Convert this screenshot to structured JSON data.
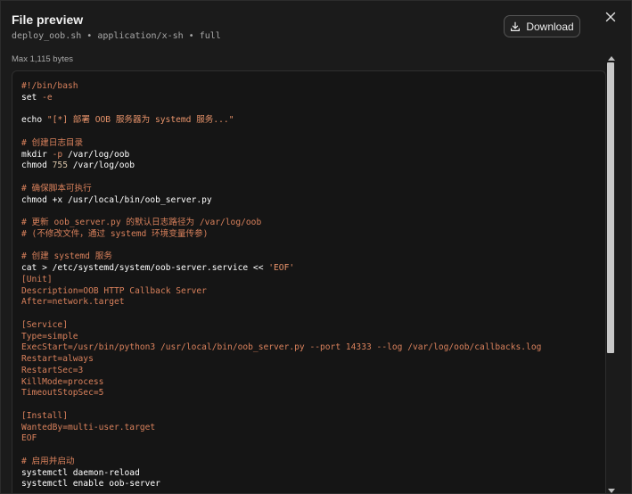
{
  "header": {
    "title": "File preview",
    "subtitle": "deploy_oob.sh • application/x-sh • full",
    "download_label": "Download"
  },
  "meta": {
    "max_bytes": "Max 1,115 bytes"
  },
  "icons": {
    "download": "download-icon",
    "close": "close-icon"
  },
  "colors": {
    "background": "#1b1b1b",
    "code_background": "#151515",
    "comment": "#d9815c",
    "command": "#ffffff",
    "string": "#e8936a"
  },
  "scroll": {
    "position": 0.0,
    "visible_fraction": 0.66
  },
  "code_lines": [
    {
      "segments": [
        {
          "t": "c-comment",
          "text": "#!/bin/bash"
        }
      ]
    },
    {
      "segments": [
        {
          "t": "c-cmd",
          "text": "set "
        },
        {
          "t": "c-flag",
          "text": "-e"
        }
      ]
    },
    {
      "segments": []
    },
    {
      "segments": [
        {
          "t": "c-cmd",
          "text": "echo "
        },
        {
          "t": "c-str",
          "text": "\"[*] 部署 OOB 服务器为 systemd 服务...\""
        }
      ]
    },
    {
      "segments": []
    },
    {
      "segments": [
        {
          "t": "c-comment",
          "text": "# 创建日志目录"
        }
      ]
    },
    {
      "segments": [
        {
          "t": "c-cmd",
          "text": "mkdir "
        },
        {
          "t": "c-flag",
          "text": "-p "
        },
        {
          "t": "c-cmd",
          "text": "/var/log/oob"
        }
      ]
    },
    {
      "segments": [
        {
          "t": "c-cmd",
          "text": "chmod "
        },
        {
          "t": "c-arg",
          "text": "755 "
        },
        {
          "t": "c-cmd",
          "text": "/var/log/oob"
        }
      ]
    },
    {
      "segments": []
    },
    {
      "segments": [
        {
          "t": "c-comment",
          "text": "# 确保脚本可执行"
        }
      ]
    },
    {
      "segments": [
        {
          "t": "c-cmd",
          "text": "chmod +x /usr/local/bin/oob_server.py"
        }
      ]
    },
    {
      "segments": []
    },
    {
      "segments": [
        {
          "t": "c-comment",
          "text": "# 更新 oob_server.py 的默认日志路径为 /var/log/oob"
        }
      ]
    },
    {
      "segments": [
        {
          "t": "c-comment",
          "text": "# (不修改文件，通过 systemd 环境变量传参)"
        }
      ]
    },
    {
      "segments": []
    },
    {
      "segments": [
        {
          "t": "c-comment",
          "text": "# 创建 systemd 服务"
        }
      ]
    },
    {
      "segments": [
        {
          "t": "c-cmd",
          "text": "cat > /etc/systemd/system/oob-server.service << "
        },
        {
          "t": "c-str",
          "text": "'EOF'"
        }
      ]
    },
    {
      "segments": [
        {
          "t": "c-ini",
          "text": "[Unit]"
        }
      ]
    },
    {
      "segments": [
        {
          "t": "c-ini",
          "text": "Description=OOB HTTP Callback Server"
        }
      ]
    },
    {
      "segments": [
        {
          "t": "c-ini",
          "text": "After=network.target"
        }
      ]
    },
    {
      "segments": []
    },
    {
      "segments": [
        {
          "t": "c-ini",
          "text": "[Service]"
        }
      ]
    },
    {
      "segments": [
        {
          "t": "c-ini",
          "text": "Type=simple"
        }
      ]
    },
    {
      "segments": [
        {
          "t": "c-ini",
          "text": "ExecStart=/usr/bin/python3 /usr/local/bin/oob_server.py --port 14333 --log /var/log/oob/callbacks.log"
        }
      ]
    },
    {
      "segments": [
        {
          "t": "c-ini",
          "text": "Restart=always"
        }
      ]
    },
    {
      "segments": [
        {
          "t": "c-ini",
          "text": "RestartSec=3"
        }
      ]
    },
    {
      "segments": [
        {
          "t": "c-ini",
          "text": "KillMode=process"
        }
      ]
    },
    {
      "segments": [
        {
          "t": "c-ini",
          "text": "TimeoutStopSec=5"
        }
      ]
    },
    {
      "segments": []
    },
    {
      "segments": [
        {
          "t": "c-ini",
          "text": "[Install]"
        }
      ]
    },
    {
      "segments": [
        {
          "t": "c-ini",
          "text": "WantedBy=multi-user.target"
        }
      ]
    },
    {
      "segments": [
        {
          "t": "c-ini",
          "text": "EOF"
        }
      ]
    },
    {
      "segments": []
    },
    {
      "segments": [
        {
          "t": "c-comment",
          "text": "# 启用并启动"
        }
      ]
    },
    {
      "segments": [
        {
          "t": "c-cmd",
          "text": "systemctl daemon-reload"
        }
      ]
    },
    {
      "segments": [
        {
          "t": "c-cmd",
          "text": "systemctl enable oob-server"
        }
      ]
    }
  ]
}
